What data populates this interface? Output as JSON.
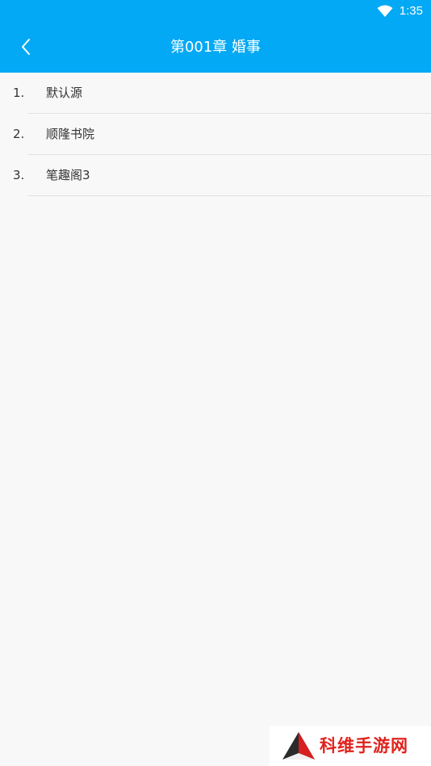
{
  "status_bar": {
    "time": "1:35",
    "wifi_icon": "wifi-icon"
  },
  "toolbar": {
    "back_icon": "chevron-left-icon",
    "title": "第001章 婚事"
  },
  "sources": [
    {
      "index": "1.",
      "label": "默认源"
    },
    {
      "index": "2.",
      "label": "顺隆书院"
    },
    {
      "index": "3.",
      "label": "笔趣阁3"
    }
  ],
  "watermark": {
    "text": "科维手游网"
  },
  "colors": {
    "accent": "#03a9f4",
    "background": "#f8f8f8",
    "text": "#333333",
    "divider": "#e2e2e2",
    "watermark_red": "#e0221c"
  }
}
